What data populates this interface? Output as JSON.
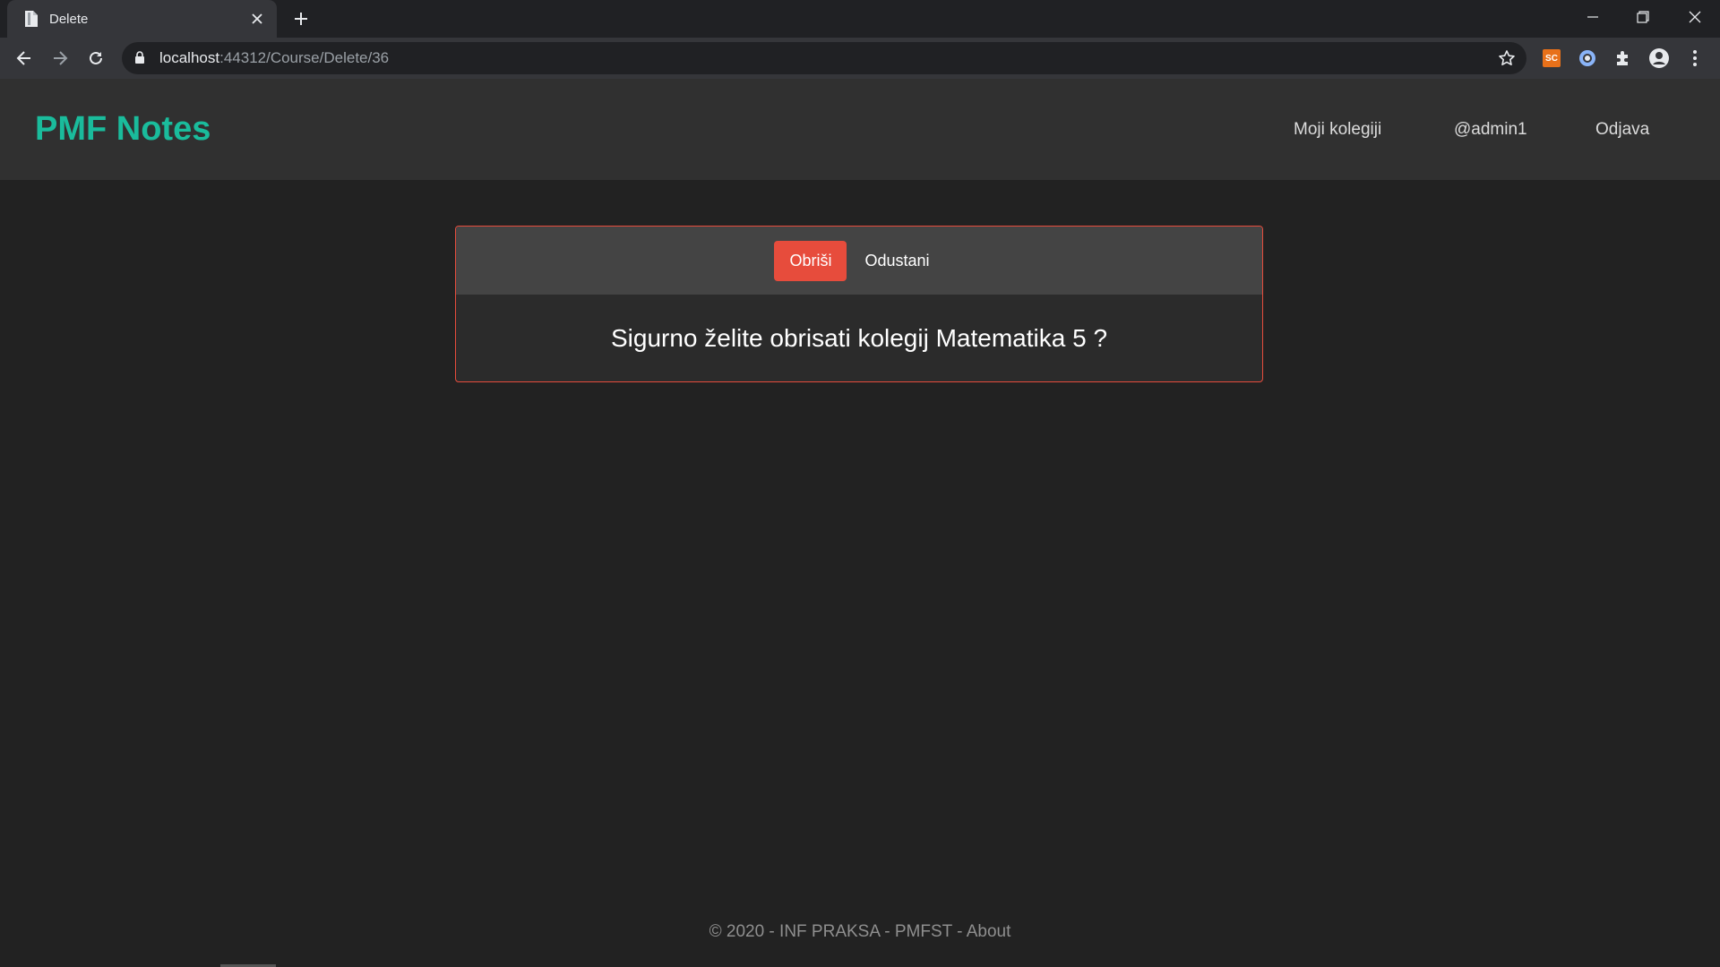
{
  "browser": {
    "tab_title": "Delete",
    "url_host": "localhost",
    "url_path": ":44312/Course/Delete/36",
    "extension_sc_label": "SC"
  },
  "navbar": {
    "brand": "PMF Notes",
    "links": [
      "Moji kolegiji",
      "@admin1",
      "Odjava"
    ]
  },
  "dialog": {
    "delete_label": "Obriši",
    "cancel_label": "Odustani",
    "message": "Sigurno želite obrisati kolegij Matematika 5 ?"
  },
  "footer": {
    "text": "© 2020 - INF PRAKSA - PMFST - ",
    "about_label": "About"
  },
  "colors": {
    "brand": "#1abc9c",
    "danger": "#e74c3c",
    "background": "#222222",
    "navbar": "#303030"
  }
}
